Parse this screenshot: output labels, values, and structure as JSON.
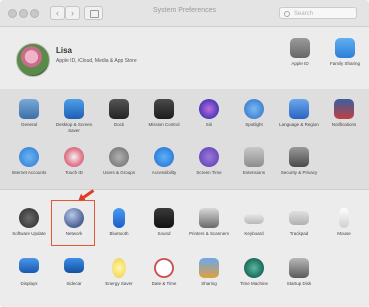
{
  "window": {
    "title": "System Preferences"
  },
  "search": {
    "placeholder": "Search"
  },
  "user": {
    "name": "Lisa",
    "subtitle": "Apple ID, iCloud, Media & App Store"
  },
  "top_right": [
    {
      "label": "Apple ID",
      "icon": "apple-id-icon"
    },
    {
      "label": "Family Sharing",
      "icon": "family-sharing-icon"
    }
  ],
  "row1": [
    {
      "label": "General",
      "icon": "general-icon"
    },
    {
      "label": "Desktop & Screen Saver",
      "icon": "desktop-icon"
    },
    {
      "label": "Dock",
      "icon": "dock-icon"
    },
    {
      "label": "Mission Control",
      "icon": "mission-control-icon"
    },
    {
      "label": "Siri",
      "icon": "siri-icon"
    },
    {
      "label": "Spotlight",
      "icon": "spotlight-icon"
    },
    {
      "label": "Language & Region",
      "icon": "language-icon"
    },
    {
      "label": "Notifications",
      "icon": "notifications-icon"
    }
  ],
  "row2": [
    {
      "label": "Internet Accounts",
      "icon": "internet-accounts-icon"
    },
    {
      "label": "Touch ID",
      "icon": "touch-id-icon"
    },
    {
      "label": "Users & Groups",
      "icon": "users-icon"
    },
    {
      "label": "Accessibility",
      "icon": "accessibility-icon"
    },
    {
      "label": "Screen Time",
      "icon": "screen-time-icon"
    },
    {
      "label": "Extensions",
      "icon": "extensions-icon"
    },
    {
      "label": "Security & Privacy",
      "icon": "security-icon"
    }
  ],
  "row3": [
    {
      "label": "Software Update",
      "icon": "software-update-icon"
    },
    {
      "label": "Network",
      "icon": "network-icon"
    },
    {
      "label": "Bluetooth",
      "icon": "bluetooth-icon"
    },
    {
      "label": "Sound",
      "icon": "sound-icon"
    },
    {
      "label": "Printers & Scanners",
      "icon": "printer-icon"
    },
    {
      "label": "Keyboard",
      "icon": "keyboard-icon"
    },
    {
      "label": "Trackpad",
      "icon": "trackpad-icon"
    },
    {
      "label": "Mouse",
      "icon": "mouse-icon"
    }
  ],
  "row4": [
    {
      "label": "Displays",
      "icon": "displays-icon"
    },
    {
      "label": "Sidecar",
      "icon": "sidecar-icon"
    },
    {
      "label": "Energy Saver",
      "icon": "energy-saver-icon"
    },
    {
      "label": "Date & Time",
      "icon": "date-time-icon"
    },
    {
      "label": "Sharing",
      "icon": "sharing-icon"
    },
    {
      "label": "Time Machine",
      "icon": "time-machine-icon"
    },
    {
      "label": "Startup Disk",
      "icon": "startup-disk-icon"
    }
  ],
  "colors": {
    "accent": "#e25a35",
    "highlight_target": "Network"
  }
}
